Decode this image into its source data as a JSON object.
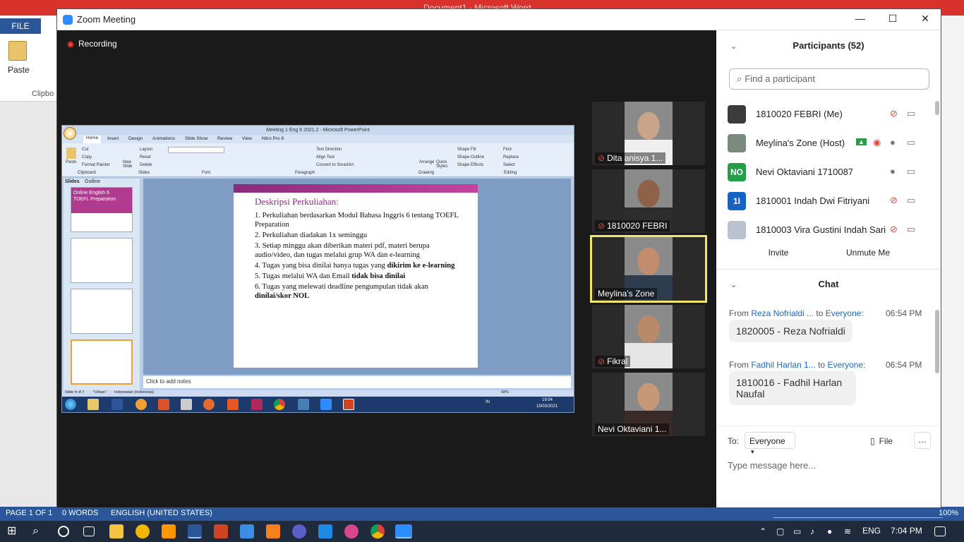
{
  "word": {
    "title": "Document1 - Microsoft Word",
    "file_tab": "FILE",
    "paste_label": "Paste",
    "clipboard_group": "Clipbo",
    "status": {
      "page": "PAGE 1 OF 1",
      "words": "0 WORDS",
      "language": "ENGLISH (UNITED STATES)",
      "zoom": "100%"
    }
  },
  "zoom": {
    "window_title": "Zoom Meeting",
    "recording_label": "Recording",
    "shared_screen": {
      "pp_title": "Meeting 1 Eng 6 2021.2 - Microsoft PowerPoint",
      "tabs": [
        "Home",
        "Insert",
        "Design",
        "Animations",
        "Slide Show",
        "Review",
        "View",
        "Nitro Pro 8"
      ],
      "ribbon_groups": [
        "Clipboard",
        "Slides",
        "Font",
        "Paragraph",
        "Drawing",
        "Editing"
      ],
      "ribbon_items": {
        "paste": "Paste",
        "cut": "Cut",
        "copy": "Copy",
        "format_painter": "Format Painter",
        "new_slide": "New Slide",
        "layout": "Layout",
        "reset": "Reset",
        "delete": "Delete",
        "text_direction": "Text Direction",
        "align_text": "Align Text",
        "convert_smartart": "Convert to SmartArt",
        "arrange": "Arrange",
        "quick_styles": "Quick Styles",
        "shape_fill": "Shape Fill",
        "shape_outline": "Shape Outline",
        "shape_effects": "Shape Effects",
        "find": "Find",
        "replace": "Replace",
        "select": "Select"
      },
      "panel_tabs": [
        "Slides",
        "Outline"
      ],
      "thumb1_title": "Online English 6",
      "thumb1_sub": "TOEFL Preparation",
      "slide_title": "Deskripsi Perkuliahan:",
      "bullets": [
        {
          "text": "1.  Perkuliahan berdasarkan Modul Bahasa Inggris 6 tentang TOEFL Preparation",
          "bold": ""
        },
        {
          "text": "2. Perkuliahan diadakan 1x seminggu",
          "bold": ""
        },
        {
          "text": "3. Setiap minggu akan diberikan materi pdf, materi berupa audio/video, dan tugas melalui grup WA dan e-learning",
          "bold": ""
        },
        {
          "text": "4. Tugas yang bisa dinilai hanya tugas yang ",
          "bold": "dikirim ke e-learning"
        },
        {
          "text": "5. Tugas melalui WA dan Email ",
          "bold": "tidak bisa dinilai"
        },
        {
          "text": "6. Tugas yang melewati deadline pengumpulan tidak akan ",
          "bold": "dinilai/skor NOL"
        }
      ],
      "notes_placeholder": "Click to add notes",
      "status_slide": "Slide 4 of 7",
      "status_theme": "\"Urban\"",
      "status_lang": "Indonesian (Indonesia)",
      "zoom_pct": "68%",
      "clock_time": "19:04",
      "clock_date": "15/03/2021",
      "tray_lang": "IN"
    },
    "video_tiles": [
      {
        "name": "Dita anisya 1...",
        "muted": true,
        "highlight": false,
        "skin": "#c9a48a",
        "cloth": "#efefef"
      },
      {
        "name": "1810020 FEBRI",
        "muted": true,
        "highlight": false,
        "skin": "#8e6248",
        "cloth": "#2d2d2d"
      },
      {
        "name": "Meylina's Zone",
        "muted": false,
        "highlight": true,
        "skin": "#c28c6e",
        "cloth": "#2e3d4d"
      },
      {
        "name": "Fikral",
        "muted": true,
        "highlight": false,
        "skin": "#b88a6a",
        "cloth": "#e6e6e6"
      },
      {
        "name": "Nevi Oktaviani 1...",
        "muted": false,
        "highlight": false,
        "skin": "#c79878",
        "cloth": "#3a2a28"
      }
    ],
    "participants": {
      "header": "Participants (52)",
      "search_placeholder": "Find a participant",
      "list": [
        {
          "name": "1810020 FEBRI (Me)",
          "avatar_text": "",
          "avatar_color": "#3b3b3b",
          "mic": "muted",
          "video": "on",
          "recording": false
        },
        {
          "name": "Meylina's Zone (Host)",
          "avatar_text": "",
          "avatar_color": "#7a8a7f",
          "mic": "on",
          "video": "on",
          "recording": true
        },
        {
          "name": "Nevi Oktaviani 1710087",
          "avatar_text": "NO",
          "avatar_color": "#23a047",
          "mic": "on",
          "video": "on",
          "recording": false
        },
        {
          "name": "1810001 Indah Dwi Fitriyani",
          "avatar_text": "1I",
          "avatar_color": "#1663c7",
          "mic": "muted",
          "video": "on",
          "recording": false
        },
        {
          "name": "1810003 Vira Gustini Indah Sari",
          "avatar_text": "",
          "avatar_color": "#b9c3cf",
          "mic": "muted",
          "video": "off",
          "recording": false
        }
      ],
      "invite": "Invite",
      "unmute_me": "Unmute Me"
    },
    "chat": {
      "header": "Chat",
      "messages": [
        {
          "from_label": "From",
          "from": "Reza Nofrialdi ...",
          "to_label": "to",
          "to": "Everyone:",
          "time": "06:54 PM",
          "text": "1820005 - Reza Nofrialdi"
        },
        {
          "from_label": "From",
          "from": "Fadhil Harlan 1...",
          "to_label": "to",
          "to": "Everyone:",
          "time": "06:54 PM",
          "text": "1810016 - Fadhil Harlan Naufal"
        }
      ],
      "to_label": "To:",
      "recipient": "Everyone",
      "file_label": "File",
      "more": "…",
      "input_placeholder": "Type message here..."
    }
  },
  "taskbar": {
    "language": "ENG",
    "time": "7:04 PM"
  },
  "colors": {
    "word_red": "#d9312b",
    "word_blue": "#2b579a",
    "zoom_blue": "#2d8cff",
    "muted_red": "#e0463b",
    "highlight": "#f1e56b"
  }
}
